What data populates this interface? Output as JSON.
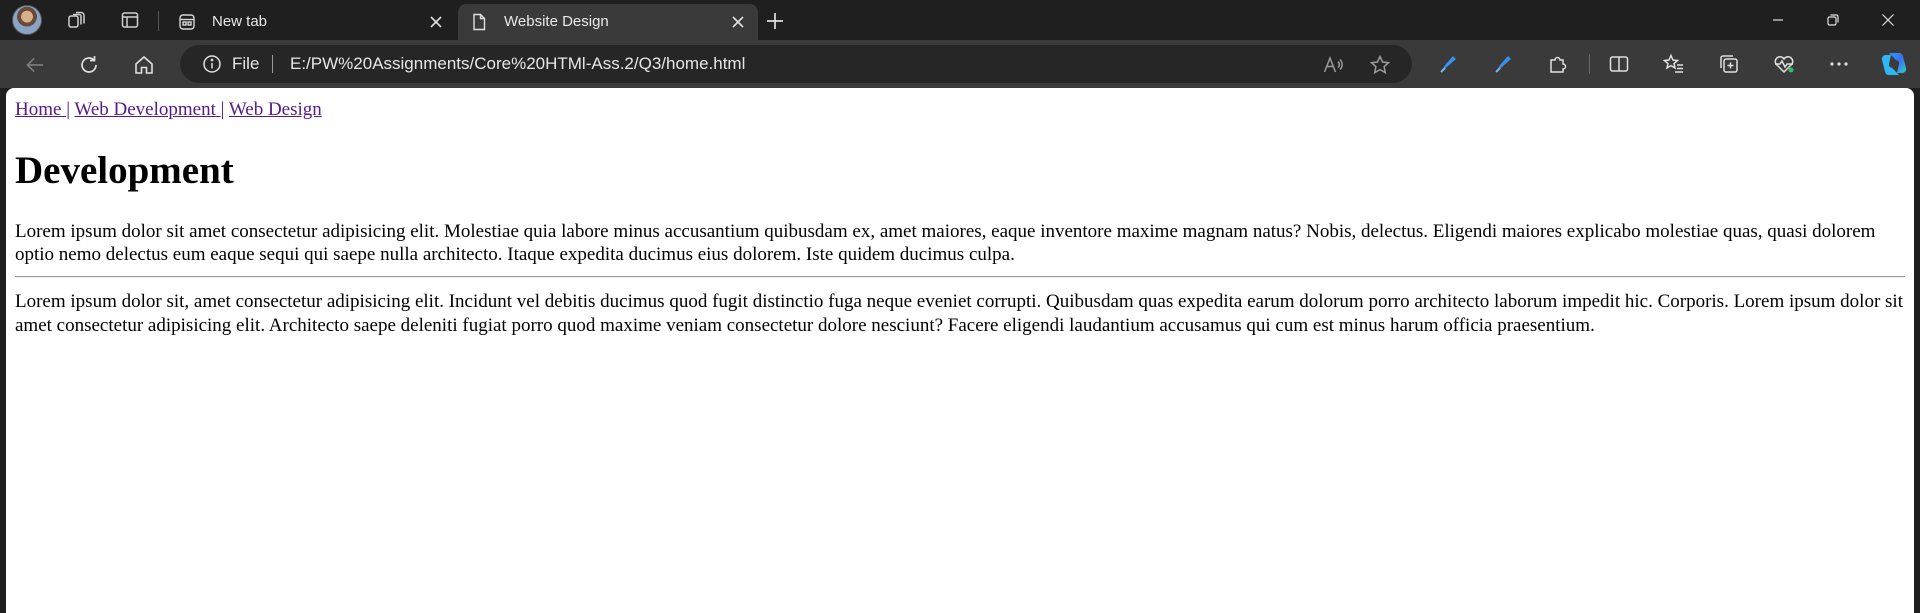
{
  "browser": {
    "tabs": [
      {
        "title": "New tab",
        "active": false
      },
      {
        "title": "Website Design",
        "active": true
      }
    ],
    "address": {
      "scheme_label": "File",
      "url": "E:/PW%20Assignments/Core%20HTMl-Ass.2/Q3/home.html"
    }
  },
  "page": {
    "nav": {
      "home": "Home ",
      "sep1": "|",
      "web_development": "Web Development ",
      "sep2": "|",
      "web_design": "Web Design"
    },
    "heading": "Development",
    "paragraph1": "Lorem ipsum dolor sit amet consectetur adipisicing elit. Molestiae quia labore minus accusantium quibusdam ex, amet maiores, eaque inventore maxime magnam natus? Nobis, delectus. Eligendi maiores explicabo molestiae quas, quasi dolorem optio nemo delectus eum eaque sequi qui saepe nulla architecto. Itaque expedita ducimus eius dolorem. Iste quidem ducimus culpa.",
    "paragraph2": "Lorem ipsum dolor sit, amet consectetur adipisicing elit. Incidunt vel debitis ducimus quod fugit distinctio fuga neque eveniet corrupti. Quibusdam quas expedita earum dolorum porro architecto laborum impedit hic. Corporis. Lorem ipsum dolor sit amet consectetur adipisicing elit. Architecto saepe deleniti fugiat porro quod maxime veniam consectetur dolore nesciunt? Facere eligendi laudantium accusamus qui cum est minus harum officia praesentium."
  },
  "icons": {
    "profile": "avatar",
    "workspaces": "workspaces-icon",
    "tab_actions": "tab-actions-icon",
    "new_tab": "plus-icon",
    "minimize": "minimize-icon",
    "restore": "restore-icon",
    "close": "close-icon",
    "back": "back-arrow-icon",
    "refresh": "refresh-icon",
    "home": "home-icon",
    "read_aloud": "read-aloud-icon",
    "favorite": "star-icon",
    "extensions": "puzzle-icon",
    "split_screen": "split-screen-icon",
    "favorites": "favorites-icon",
    "collections": "collections-icon",
    "performance": "heart-pulse-icon",
    "more": "more-icon",
    "copilot": "copilot-icon"
  },
  "colors": {
    "chrome_dark": "#1f1f1f",
    "toolbar": "#3a3a3a",
    "link_visited": "#551a8b",
    "accent_blue": "#3b8eea"
  }
}
